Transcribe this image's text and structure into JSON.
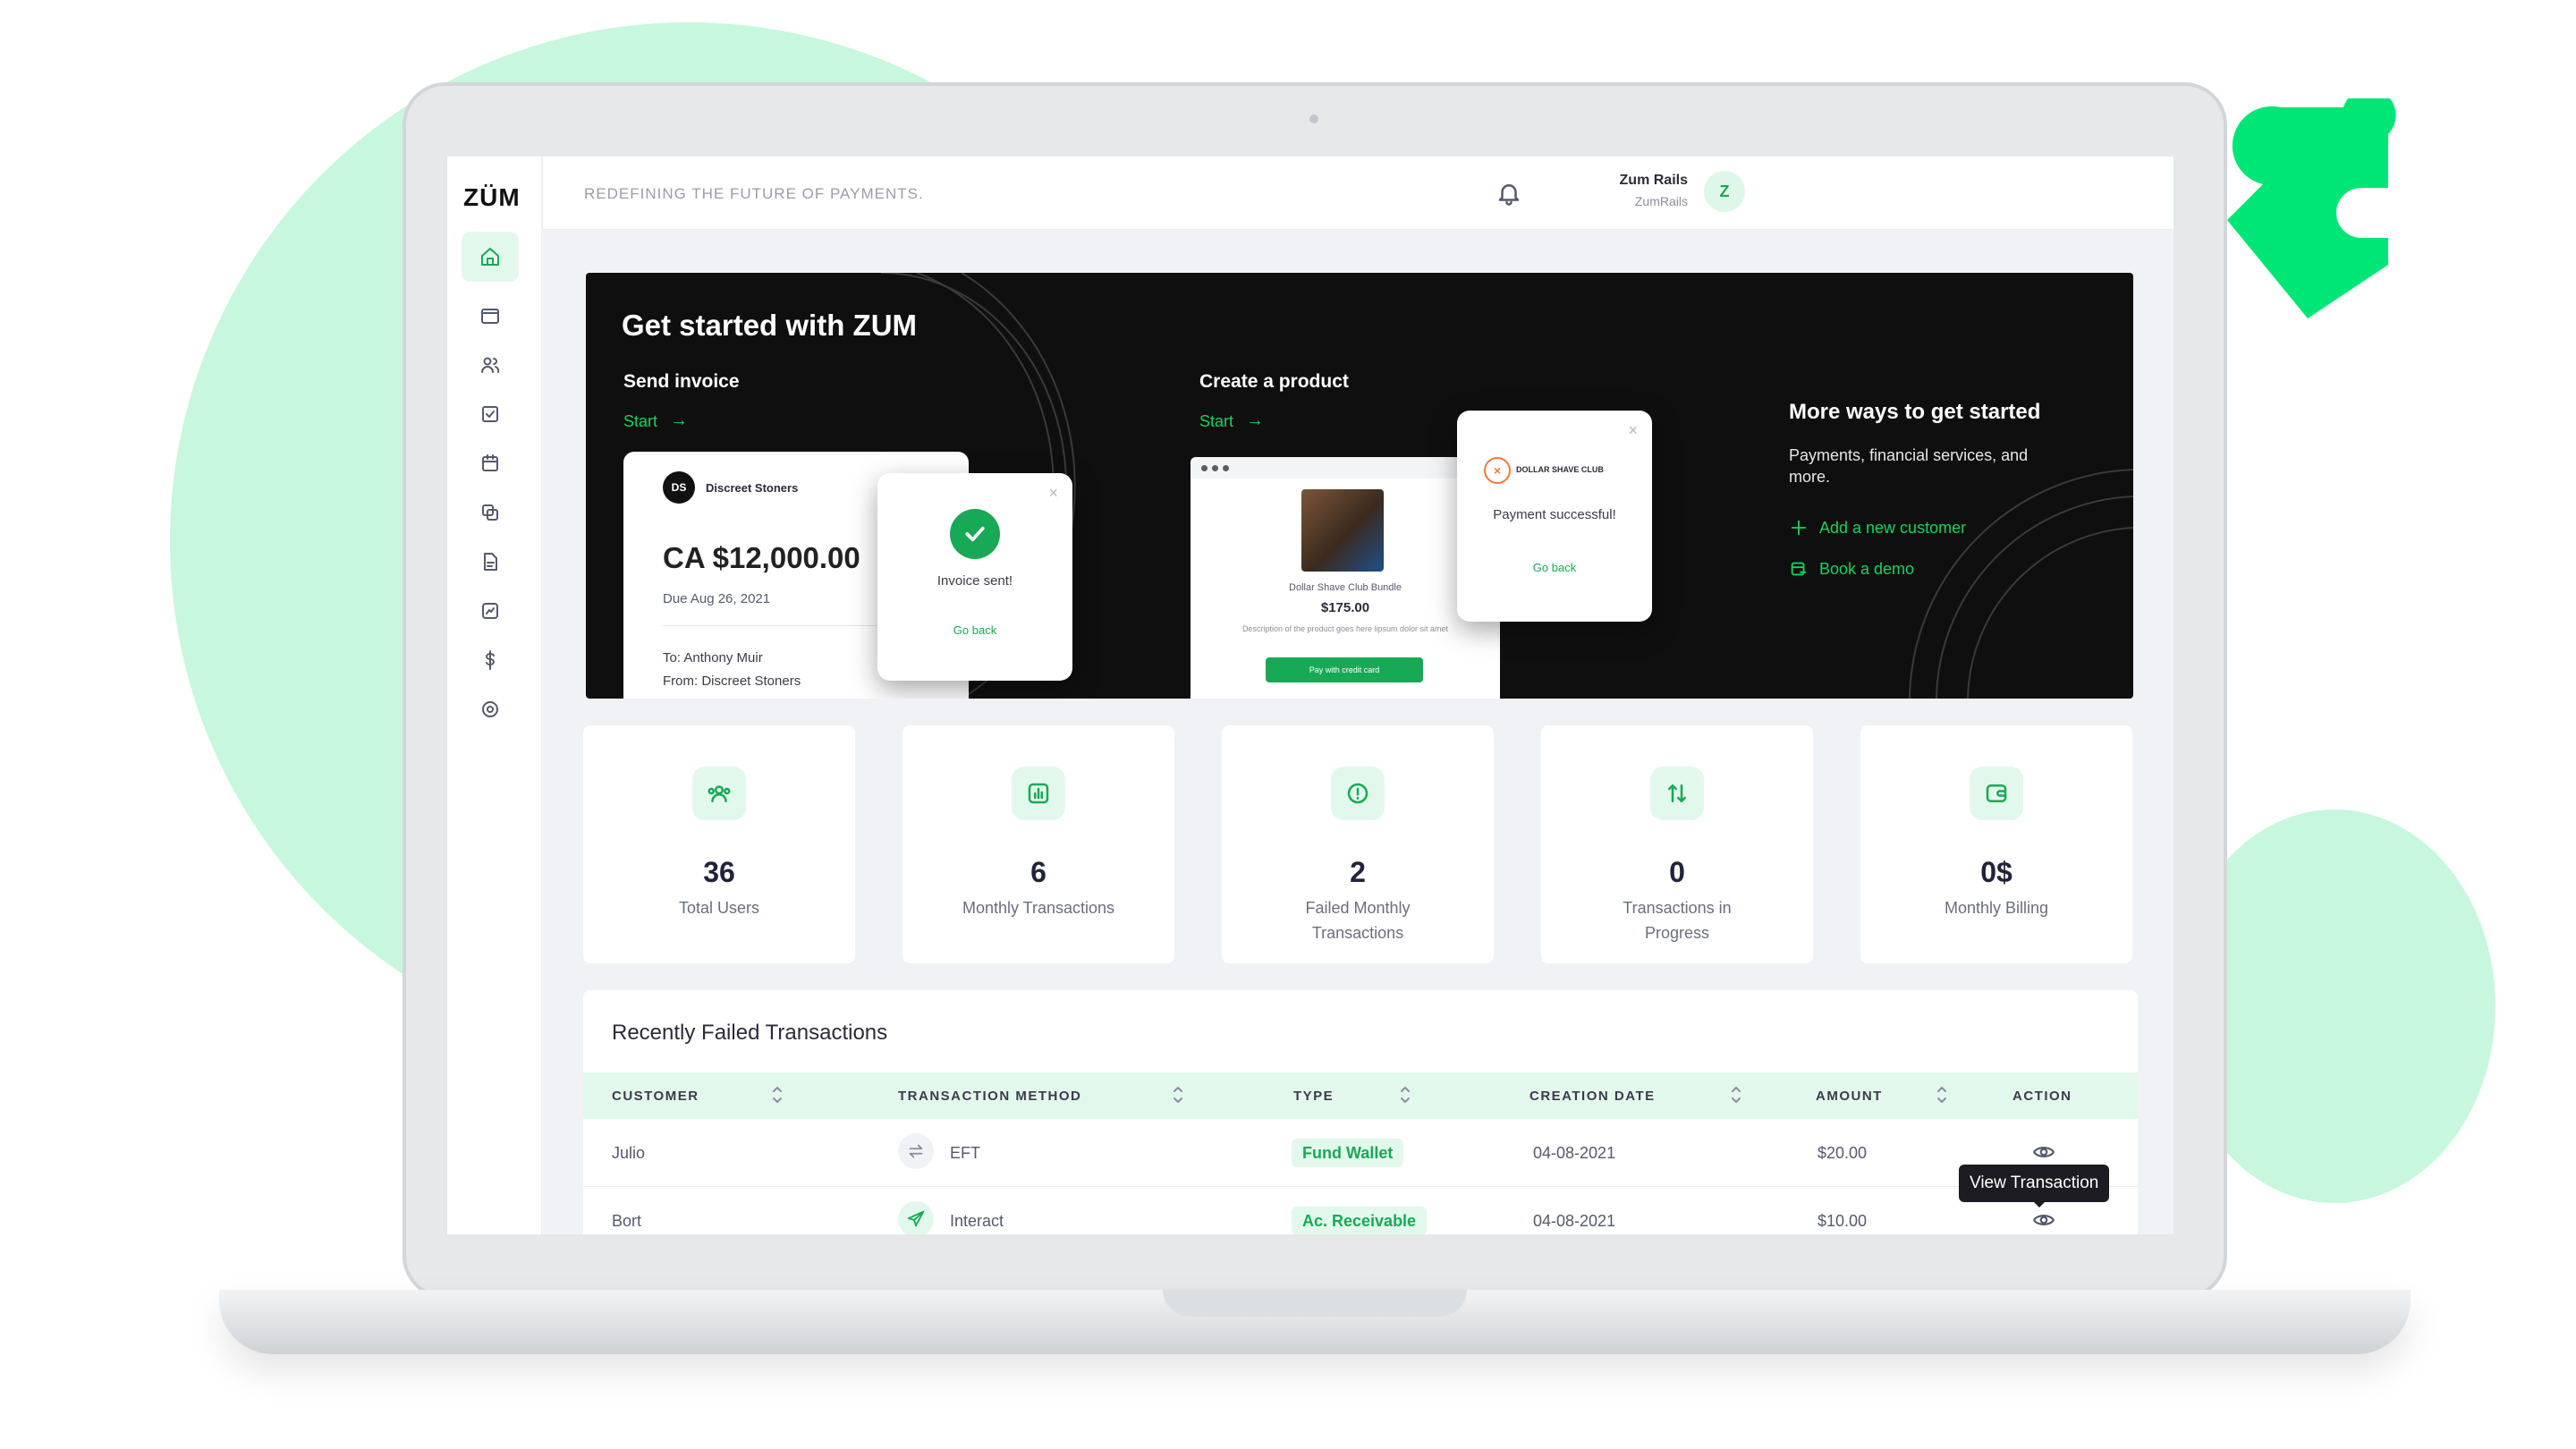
{
  "brand": {
    "logo_text": "ZÜM",
    "accent": "#18a956",
    "accent_bright": "#18d25f",
    "accent_light": "#e3f8ec"
  },
  "topbar": {
    "tagline": "REDEFINING THE FUTURE OF PAYMENTS.",
    "notification_icon": "bell-icon",
    "user": {
      "name": "Zum Rails",
      "org": "ZumRails",
      "avatar_initial": "Z"
    }
  },
  "sidebar": {
    "items": [
      {
        "icon": "home-icon",
        "active": true
      },
      {
        "icon": "folder-icon",
        "active": false
      },
      {
        "icon": "users-icon",
        "active": false
      },
      {
        "icon": "checklist-icon",
        "active": false
      },
      {
        "icon": "calendar-icon",
        "active": false
      },
      {
        "icon": "copy-icon",
        "active": false
      },
      {
        "icon": "document-icon",
        "active": false
      },
      {
        "icon": "report-icon",
        "active": false
      },
      {
        "icon": "dollar-icon",
        "active": false
      },
      {
        "icon": "settings-icon",
        "active": false
      }
    ]
  },
  "hero": {
    "title": "Get started with ZUM",
    "send_invoice": {
      "label": "Send invoice",
      "start": "Start",
      "arrow": "→"
    },
    "invoice_card": {
      "company": "Discreet Stoners",
      "amount": "CA $12,000.00",
      "due": "Due Aug 26, 2021",
      "to": "To: Anthony Muir",
      "from": "From: Discreet Stoners"
    },
    "invoice_popup": {
      "message": "Invoice sent!",
      "link": "Go back",
      "close": "×"
    },
    "create_product": {
      "label": "Create a product",
      "start": "Start",
      "arrow": "→"
    },
    "product_page": {
      "name": "Dollar Shave Club Bundle",
      "price": "$175.00",
      "description": "Description of the product goes here lipsum dolor sit amet",
      "button": "Pay with credit card"
    },
    "payment_popup": {
      "brand": "DOLLAR SHAVE CLUB",
      "message": "Payment successful!",
      "link": "Go back",
      "close": "×"
    },
    "more": {
      "title": "More ways to get started",
      "description": "Payments, financial services, and more.",
      "links": [
        {
          "label": "Add a new customer",
          "icon": "plus-icon"
        },
        {
          "label": "Book a demo",
          "icon": "calendar-link-icon"
        }
      ]
    }
  },
  "stats": [
    {
      "value": "36",
      "label": "Total Users",
      "icon": "users-group-icon"
    },
    {
      "value": "6",
      "label": "Monthly Transactions",
      "icon": "bar-chart-icon"
    },
    {
      "value": "2",
      "label": "Failed Monthly Transactions",
      "icon": "alert-circle-icon"
    },
    {
      "value": "0",
      "label": "Transactions in Progress",
      "icon": "swap-arrows-icon"
    },
    {
      "value": "0$",
      "label": "Monthly Billing",
      "icon": "wallet-icon"
    }
  ],
  "failed_table": {
    "title": "Recently Failed Transactions",
    "columns": [
      "CUSTOMER",
      "TRANSACTION METHOD",
      "TYPE",
      "CREATION DATE",
      "AMOUNT",
      "ACTION"
    ],
    "rows": [
      {
        "customer": "Julio",
        "method": "EFT",
        "method_icon": "transfer-arrows-icon",
        "type": "Fund Wallet",
        "date": "04-08-2021",
        "amount": "$20.00",
        "action_icon": "eye-icon"
      },
      {
        "customer": "Bort",
        "method": "Interact",
        "method_icon": "send-icon",
        "type": "Ac. Receivable",
        "date": "04-08-2021",
        "amount": "$10.00",
        "action_icon": "eye-icon"
      }
    ],
    "tooltip": "View Transaction"
  }
}
